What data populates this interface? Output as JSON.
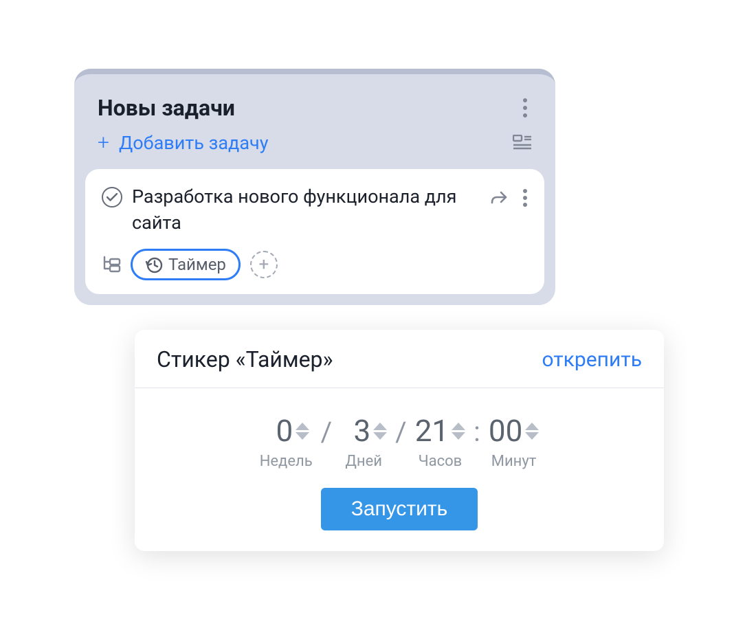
{
  "column": {
    "title": "Новы задачи",
    "add_label": "Добавить задачу"
  },
  "task": {
    "title": "Разработка нового функционала для сайта",
    "timer_chip_label": "Таймер"
  },
  "popover": {
    "title": "Стикер «Таймер»",
    "detach_label": "открепить",
    "units": {
      "weeks": {
        "value": "0",
        "label": "Недель"
      },
      "days": {
        "value": "3",
        "label": "Дней"
      },
      "hours": {
        "value": "21",
        "label": "Часов"
      },
      "minutes": {
        "value": "00",
        "label": "Минут"
      }
    },
    "sep_slash": "/",
    "sep_colon": ":",
    "start_label": "Запустить"
  }
}
